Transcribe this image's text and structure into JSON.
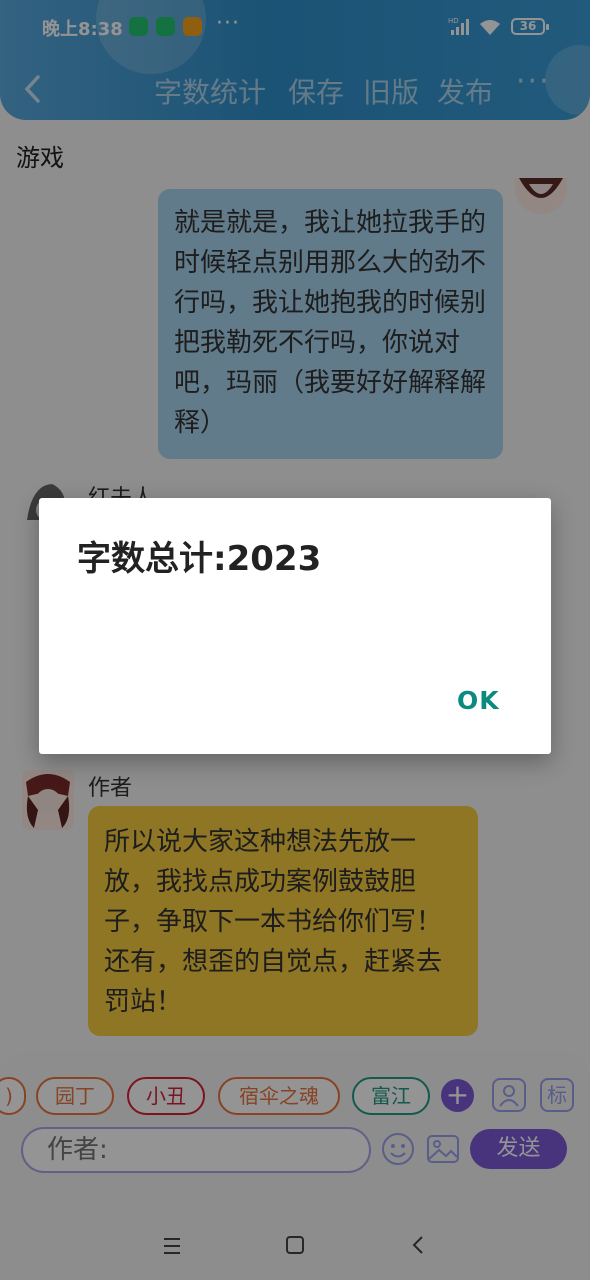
{
  "status_bar": {
    "time": "晚上8:38",
    "more": "···",
    "network": "HD",
    "battery": "36"
  },
  "toolbar": {
    "actions": [
      "字数统计",
      "保存",
      "旧版",
      "发布"
    ],
    "more": "···"
  },
  "chat": {
    "section_label": "游戏",
    "messages": [
      {
        "side": "right",
        "text": "就是就是，我让她拉我手的时候轻点别用那么大的劲不行吗，我让她抱我的时候别把我勒死不行吗，你说对吧，玛丽（我要好好解释解释）"
      },
      {
        "side": "left",
        "sender": "红夫人",
        "text": ""
      },
      {
        "side": "left",
        "sender": "作者",
        "text": "所以说大家这种想法先放一放，我找点成功案例鼓鼓胆子，争取下一本书给你们写！还有，想歪的自觉点，赶紧去罚站！"
      }
    ]
  },
  "input_bar": {
    "chips": [
      {
        "label": ")",
        "color": "#e8743e"
      },
      {
        "label": "园丁",
        "color": "#e8743e"
      },
      {
        "label": "小丑",
        "color": "#d4213a"
      },
      {
        "label": "宿伞之魂",
        "color": "#e8743e"
      },
      {
        "label": "富江",
        "color": "#1f9c85"
      }
    ],
    "plus": "+",
    "mark_button": "标",
    "placeholder": "作者:",
    "send_label": "发送"
  },
  "dialog": {
    "message": "字数总计:2023",
    "ok_label": "OK"
  },
  "colors": {
    "top_bar": "#3a9bd6",
    "right_bubble": "#a9d4f0",
    "left_bubble": "#f5cc3e",
    "accent_purple": "#7b5bd6",
    "dialog_button": "#0b8a80"
  }
}
